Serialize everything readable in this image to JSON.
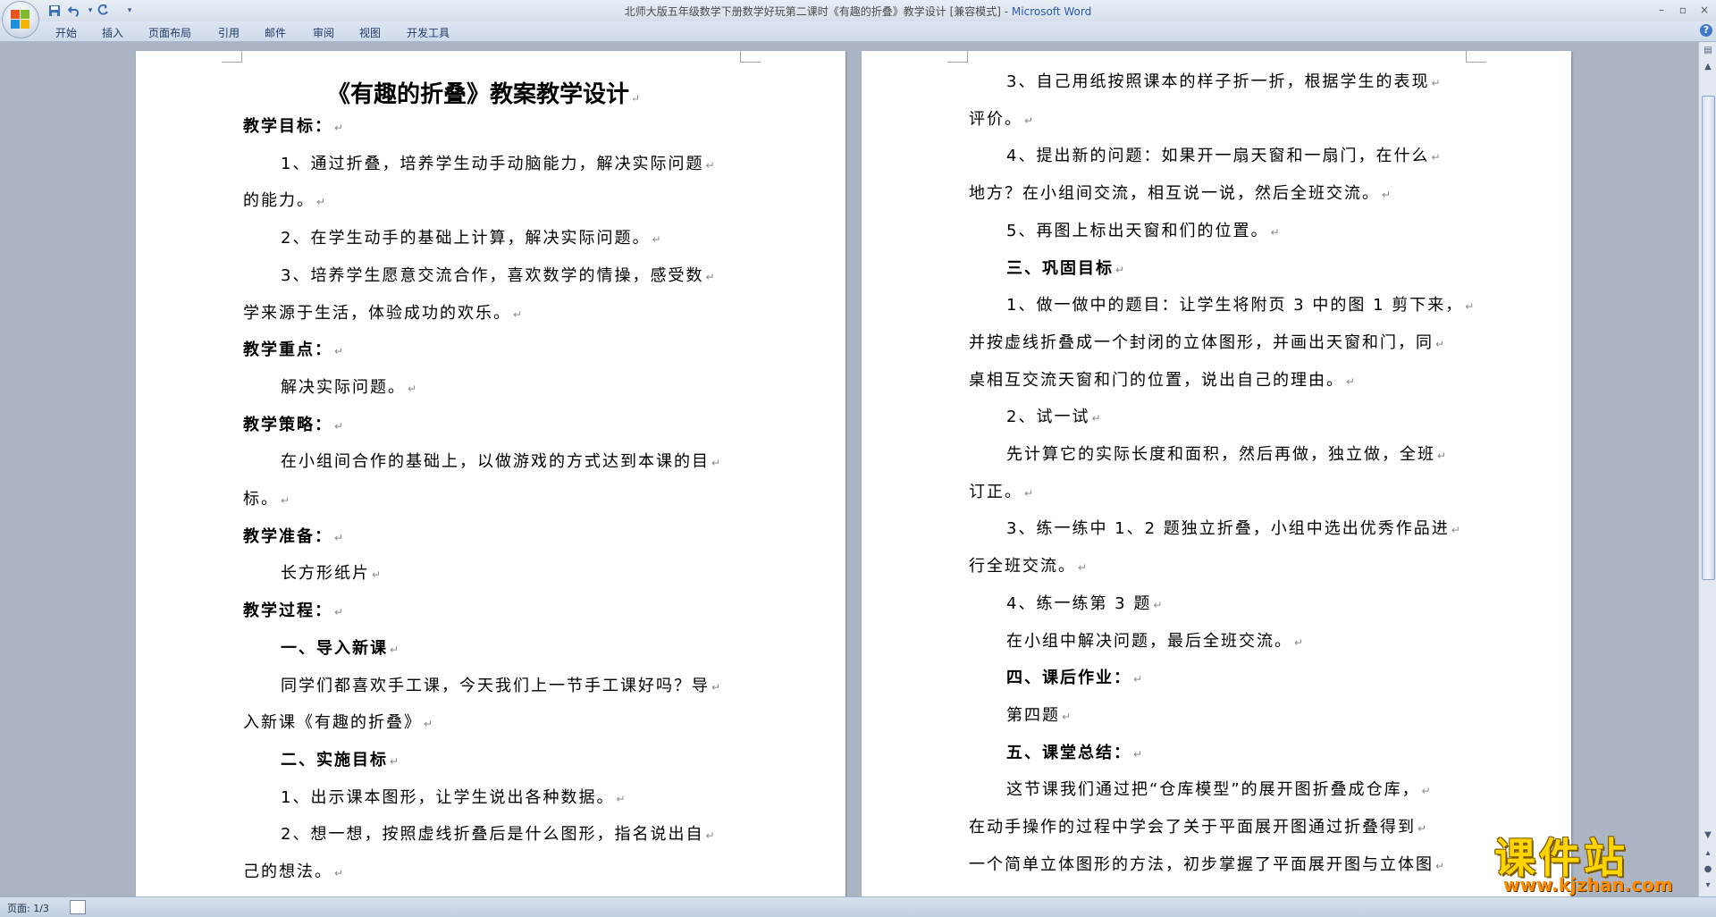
{
  "window": {
    "title": "北师大版五年级数学下册数学好玩第二课时《有趣的折叠》教学设计 [兼容模式] - ",
    "app_name": "Microsoft Word"
  },
  "qat": {
    "save_icon": "save-icon",
    "undo_icon": "undo-icon",
    "redo_icon": "redo-icon"
  },
  "ribbon": {
    "tabs": [
      "开始",
      "插入",
      "页面布局",
      "引用",
      "邮件",
      "审阅",
      "视图",
      "开发工具"
    ],
    "help": "?"
  },
  "left_page": {
    "title": "《有趣的折叠》教案教学设计",
    "lines": [
      {
        "text": "教学目标：",
        "bold": true
      },
      {
        "text": "1、通过折叠，培养学生动手动脑能力，解决实际问题",
        "bold": false
      },
      {
        "text": "的能力。",
        "bold": false
      },
      {
        "text": "2、在学生动手的基础上计算，解决实际问题。",
        "bold": false
      },
      {
        "text": "3、培养学生愿意交流合作，喜欢数学的情操，感受数",
        "bold": false
      },
      {
        "text": "学来源于生活，体验成功的欢乐。",
        "bold": false
      },
      {
        "text": "教学重点：",
        "bold": true
      },
      {
        "text": "解决实际问题。",
        "bold": false
      },
      {
        "text": "教学策略：",
        "bold": true
      },
      {
        "text": "在小组间合作的基础上，以做游戏的方式达到本课的目",
        "bold": false
      },
      {
        "text": "标。",
        "bold": false
      },
      {
        "text": "教学准备：",
        "bold": true
      },
      {
        "text": "长方形纸片",
        "bold": false
      },
      {
        "text": "教学过程：",
        "bold": true
      },
      {
        "text": "一、导入新课",
        "bold": true
      },
      {
        "text": "同学们都喜欢手工课，今天我们上一节手工课好吗？导",
        "bold": false
      },
      {
        "text": "入新课《有趣的折叠》",
        "bold": false
      },
      {
        "text": "二、实施目标",
        "bold": true
      },
      {
        "text": "1、出示课本图形，让学生说出各种数据。",
        "bold": false
      },
      {
        "text": "2、想一想，按照虚线折叠后是什么图形，指名说出自",
        "bold": false
      },
      {
        "text": "己的想法。",
        "bold": false
      }
    ]
  },
  "right_page": {
    "lines": [
      {
        "text": "3、自己用纸按照课本的样子折一折，根据学生的表现",
        "bold": false
      },
      {
        "text": "评价。",
        "bold": false
      },
      {
        "text": "4、提出新的问题：如果开一扇天窗和一扇门，在什么",
        "bold": false
      },
      {
        "text": "地方？在小组间交流，相互说一说，然后全班交流。",
        "bold": false
      },
      {
        "text": "5、再图上标出天窗和们的位置。",
        "bold": false
      },
      {
        "text": "三、巩固目标",
        "bold": true
      },
      {
        "text": "1、做一做中的题目：让学生将附页 3 中的图 1 剪下来，",
        "bold": false
      },
      {
        "text": "并按虚线折叠成一个封闭的立体图形，并画出天窗和门，同",
        "bold": false
      },
      {
        "text": "桌相互交流天窗和门的位置，说出自己的理由。",
        "bold": false
      },
      {
        "text": "2、试一试",
        "bold": false
      },
      {
        "text": "先计算它的实际长度和面积，然后再做，独立做，全班",
        "bold": false
      },
      {
        "text": "订正。",
        "bold": false
      },
      {
        "text": "3、练一练中 1、2 题独立折叠，小组中选出优秀作品进",
        "bold": false
      },
      {
        "text": "行全班交流。",
        "bold": false
      },
      {
        "text": "4、练一练第 3 题",
        "bold": false
      },
      {
        "text": "在小组中解决问题，最后全班交流。",
        "bold": false
      },
      {
        "text": "四、课后作业：",
        "bold": true
      },
      {
        "text": "第四题",
        "bold": false
      },
      {
        "text": "五、课堂总结：",
        "bold": true
      },
      {
        "text": "这节课我们通过把“仓库模型”的展开图折叠成仓库，",
        "bold": false
      },
      {
        "text": "在动手操作的过程中学会了关于平面展开图通过折叠得到",
        "bold": false
      },
      {
        "text": "一个简单立体图形的方法，初步掌握了平面展开图与立体图",
        "bold": false
      }
    ]
  },
  "paragraph_mark": "↵",
  "status": {
    "page": "页面: 1/3"
  },
  "watermark": {
    "cn": "课件站",
    "url": "www.kjzhan.com"
  }
}
